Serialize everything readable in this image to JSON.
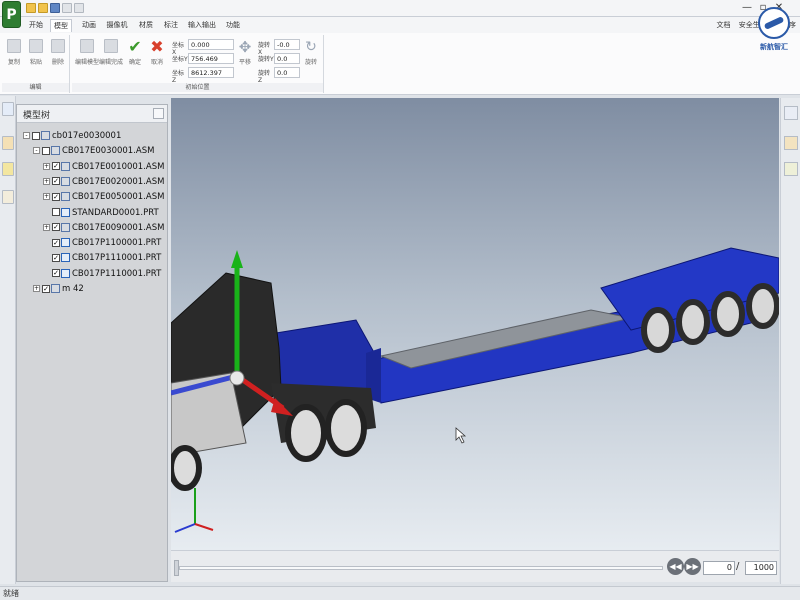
{
  "app": {
    "logo_letter": "P",
    "brand_text": "新航智汇",
    "window_controls": [
      "—",
      "▫",
      "✕"
    ]
  },
  "menu": {
    "tabs": [
      "开始",
      "模型",
      "动画",
      "摄像机",
      "材质",
      "标注",
      "输入输出",
      "功能"
    ],
    "active": "模型",
    "right_links": [
      "文档",
      "安全生",
      "实用程序"
    ]
  },
  "ribbon": {
    "edit_group": {
      "label": "编辑",
      "buttons": [
        "复制",
        "粘贴",
        "删除"
      ]
    },
    "init_group": {
      "label": "初始位置",
      "buttons": [
        "编辑模型",
        "编辑完成",
        "确定",
        "取消"
      ],
      "coords": [
        {
          "label": "坐标X",
          "value": "0.000"
        },
        {
          "label": "坐标Y",
          "value": "756.469"
        },
        {
          "label": "坐标Z",
          "value": "8612.397"
        }
      ],
      "translate_label": "平移",
      "rotations": [
        {
          "label": "旋转X",
          "value": "-0.0"
        },
        {
          "label": "旋转Y",
          "value": "0.0"
        },
        {
          "label": "旋转Z",
          "value": "0.0"
        }
      ],
      "rotate_label": "旋转"
    }
  },
  "tree": {
    "title": "模型树",
    "nodes": [
      {
        "label": "cb017e0030001",
        "level": 0,
        "expander": "-",
        "checked": false,
        "part": false
      },
      {
        "label": "CB017E0030001.ASM",
        "level": 1,
        "expander": "-",
        "checked": false,
        "part": false
      },
      {
        "label": "CB017E0010001.ASM",
        "level": 2,
        "expander": "+",
        "checked": true,
        "part": false
      },
      {
        "label": "CB017E0020001.ASM",
        "level": 2,
        "expander": "+",
        "checked": true,
        "part": false
      },
      {
        "label": "CB017E0050001.ASM",
        "level": 2,
        "expander": "+",
        "checked": true,
        "part": false
      },
      {
        "label": "STANDARD0001.PRT",
        "level": 2,
        "expander": "",
        "checked": false,
        "part": true
      },
      {
        "label": "CB017E0090001.ASM",
        "level": 2,
        "expander": "+",
        "checked": true,
        "part": false
      },
      {
        "label": "CB017P1100001.PRT",
        "level": 2,
        "expander": "",
        "checked": true,
        "part": true
      },
      {
        "label": "CB017P1110001.PRT",
        "level": 2,
        "expander": "",
        "checked": true,
        "part": true
      },
      {
        "label": "CB017P1110001.PRT",
        "level": 2,
        "expander": "",
        "checked": true,
        "part": true
      },
      {
        "label": "m 42",
        "level": 1,
        "expander": "+",
        "checked": true,
        "part": false
      }
    ]
  },
  "timeline": {
    "current_frame": "0",
    "separator": "/",
    "total_frames": "1000",
    "progress": 0
  },
  "status": {
    "text": "就绪"
  }
}
